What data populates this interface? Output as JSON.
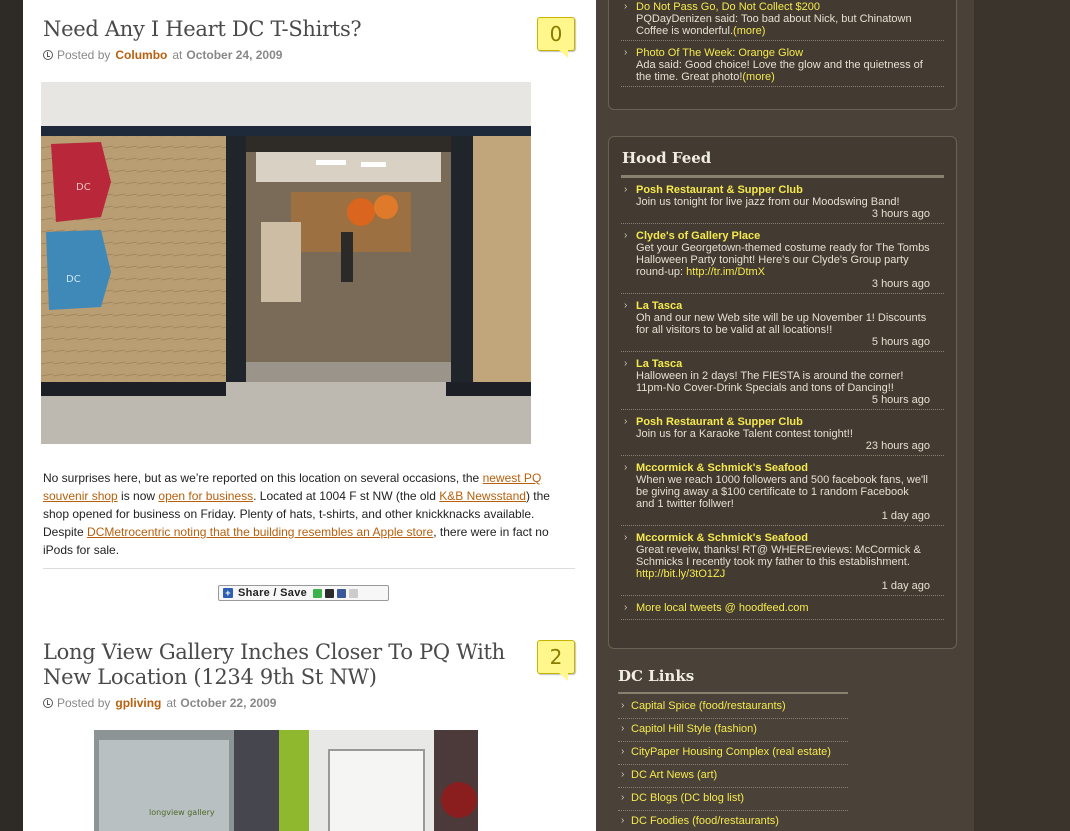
{
  "posts": [
    {
      "title": "Need Any I Heart DC T-Shirts?",
      "comments": "0",
      "posted_by": "Posted by",
      "author": "Columbo",
      "at": "at",
      "date": "October 24, 2009",
      "body": {
        "t1": "No surprises here, but as we’re reported on this location on several occasions, the ",
        "l1": "newest PQ souvenir shop",
        "t2": " is now ",
        "l2": "open for business",
        "t3": ".  Located at 1004 F st NW (the old ",
        "l3": "K&B Newsstand",
        "t4": ") the shop opened for business on Friday.  Plenty of hats, t-shirts, and other knickknacks available.  Despite ",
        "l4": "DCMetrocentric noting that the building resembles an Apple store",
        "t5": ", there were in fact no iPods for sale."
      },
      "share_label": "Share / Save"
    },
    {
      "title": "Long View Gallery Inches Closer To PQ With New Location (1234 9th St NW)",
      "comments": "2",
      "posted_by": "Posted by",
      "author": "gpliving",
      "at": "at",
      "date": "October 22, 2009"
    }
  ],
  "top_widget": {
    "items": [
      {
        "title": "Do Not Pass Go, Do Not Collect $200",
        "text": "PQDayDenizen said: Too bad about Nick, but Chinatown Coffee is wonderful.",
        "more": "(more)"
      },
      {
        "title": "Photo Of The Week: Orange Glow",
        "text": "Ada said: Good choice! Love the glow and the quietness of the time. Great photo!",
        "more": "(more)"
      }
    ]
  },
  "hood_feed": {
    "title": "Hood Feed",
    "items": [
      {
        "name": "Posh Restaurant & Supper Club",
        "text": "Join us tonight for live jazz from our Moodswing Band!",
        "link": "",
        "time": "3 hours ago"
      },
      {
        "name": "Clyde's of Gallery Place",
        "text": "Get your Georgetown-themed costume ready for The Tombs Halloween Party tonight! Here's our Clyde's Group party round-up: ",
        "link": "http://tr.im/DtmX",
        "time": "3 hours ago"
      },
      {
        "name": "La Tasca",
        "text": "Oh and our new Web site will be up November 1! Discounts for all visitors to be valid at all locations!!",
        "link": "",
        "time": "5 hours ago"
      },
      {
        "name": "La Tasca",
        "text": "Halloween in 2 days! The FIESTA is around the corner! 11pm-No Cover-Drink Specials and tons of Dancing!!",
        "link": "",
        "time": "5 hours ago"
      },
      {
        "name": "Posh Restaurant & Supper Club",
        "text": "Join us for a Karaoke Talent contest tonight!!",
        "link": "",
        "time": "23 hours ago"
      },
      {
        "name": "Mccormick & Schmick's Seafood",
        "text": "When we reach 1000 followers and 500 facebook fans, we'll be giving away a $100 certificate to 1 random Facebook and 1 twitter follwer!",
        "link": "",
        "time": "1 day ago"
      },
      {
        "name": "Mccormick & Schmick's Seafood",
        "text": "Great reveiw, thanks! RT@ WHEREreviews: McCormick & Schmicks I recently took my father to this establishment. ",
        "link": "http://bit.ly/3tO1ZJ",
        "time": "1 day ago"
      }
    ],
    "more": "More local tweets @ hoodfeed.com"
  },
  "dc_links": {
    "title": "DC Links",
    "items": [
      "Capital Spice (food/restaurants)",
      "Capitol Hill Style (fashion)",
      "CityPaper Housing Complex (real estate)",
      "DC Art News (art)",
      "DC Blogs (DC blog list)",
      "DC Foodies (food/restaurants)"
    ]
  },
  "photo1_text": {
    "shirt_left": "DC",
    "shirt_bottom": "DC"
  },
  "photo2_text": {
    "sign": "longview gallery"
  }
}
